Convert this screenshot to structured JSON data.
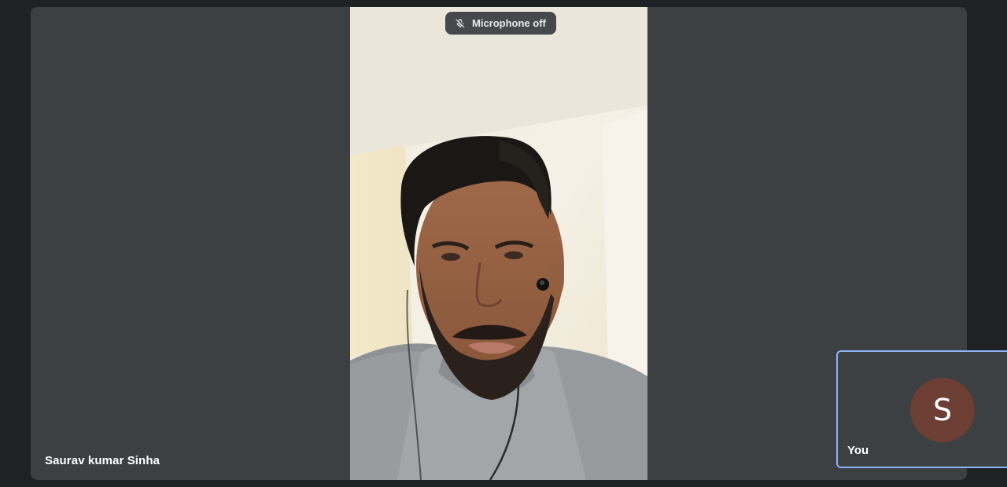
{
  "call": {
    "status_pill": {
      "text": "Microphone off",
      "icon": "microphone-off-icon"
    },
    "main_participant": {
      "name": "Saurav kumar Sinha"
    },
    "self_view": {
      "label": "You",
      "avatar_initial": "S",
      "avatar_color": "#6d3e33",
      "border_color": "#8ab4f8"
    }
  },
  "colors": {
    "background": "#202124",
    "tile": "#3c4043",
    "pill": "#3c4043",
    "text": "#ffffff"
  }
}
